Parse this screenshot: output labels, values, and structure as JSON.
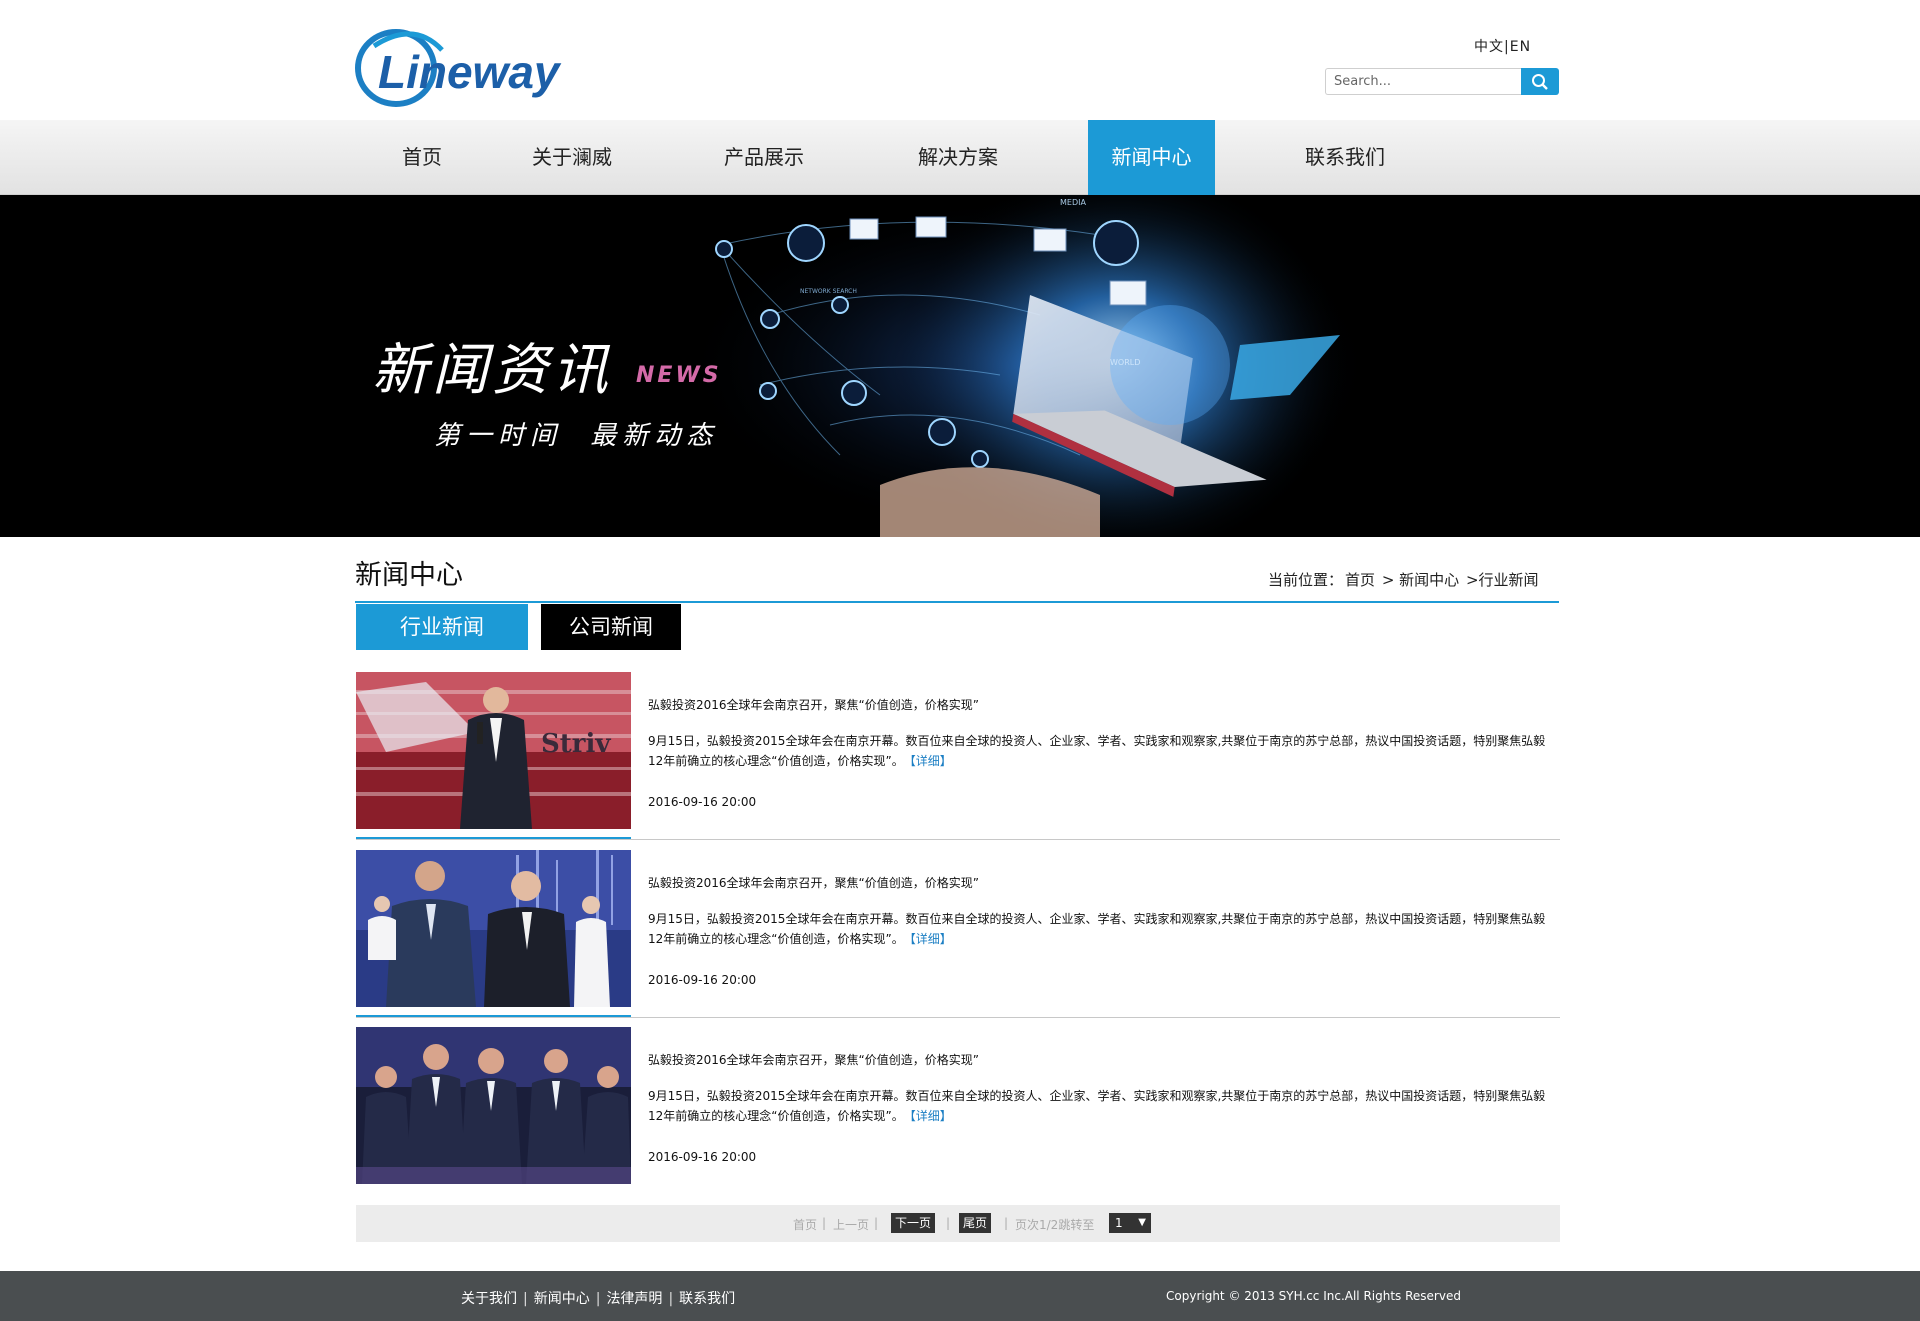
{
  "header": {
    "logo_text": "Lineway",
    "lang_zh": "中文",
    "lang_sep": "|",
    "lang_en": "EN",
    "search_placeholder": "Search..."
  },
  "nav": {
    "items": [
      {
        "label": "首页"
      },
      {
        "label": "关于澜威"
      },
      {
        "label": "产品展示"
      },
      {
        "label": "解决方案"
      },
      {
        "label": "新闻中心"
      },
      {
        "label": "联系我们"
      }
    ],
    "active": "新闻中心"
  },
  "banner": {
    "title": "新闻资讯",
    "title_en": "NEWS",
    "subtitle": "第一时间 最新动态"
  },
  "section": {
    "title": "新闻中心",
    "breadcrumb_prefix": "当前位置：",
    "breadcrumb": [
      "首页",
      "> 新闻中心",
      ">行业新闻"
    ],
    "tabs": [
      {
        "label": "行业新闻"
      },
      {
        "label": "公司新闻"
      }
    ]
  },
  "news": [
    {
      "title": "弘毅投资2016全球年会南京召开，聚焦“价值创造，价格实现”",
      "desc": "9月15日，弘毅投资2015全球年会在南京开幕。数百位来自全球的投资人、企业家、学者、实践家和观察家,共聚位于南京的苏宁总部，热议中国投资话题，特别聚焦弘毅12年前确立的核心理念“价值创造，价格实现”。",
      "more": "【详细】",
      "date": "2016-09-16 20:00"
    },
    {
      "title": "弘毅投资2016全球年会南京召开，聚焦“价值创造，价格实现”",
      "desc": "9月15日，弘毅投资2015全球年会在南京开幕。数百位来自全球的投资人、企业家、学者、实践家和观察家,共聚位于南京的苏宁总部，热议中国投资话题，特别聚焦弘毅12年前确立的核心理念“价值创造，价格实现”。",
      "more": "【详细】",
      "date": "2016-09-16 20:00"
    },
    {
      "title": "弘毅投资2016全球年会南京召开，聚焦“价值创造，价格实现”",
      "desc": "9月15日，弘毅投资2015全球年会在南京开幕。数百位来自全球的投资人、企业家、学者、实践家和观察家,共聚位于南京的苏宁总部，热议中国投资话题，特别聚焦弘毅12年前确立的核心理念“价值创造，价格实现”。",
      "more": "【详细】",
      "date": "2016-09-16 20:00"
    }
  ],
  "pager": {
    "first": "首页",
    "prev": "上一页",
    "next": "下一页",
    "last": "尾页",
    "info": "页次1/2跳转至",
    "current": "1"
  },
  "footer": {
    "links": [
      "关于我们",
      "新闻中心",
      "法律声明",
      "联系我们"
    ],
    "copyright": "Copyright © 2013 SYH.cc Inc.All Rights Reserved"
  },
  "colors": {
    "accent": "#1c9ad6",
    "footer_bg": "#4a4e50",
    "banner_bg": "#000000"
  }
}
